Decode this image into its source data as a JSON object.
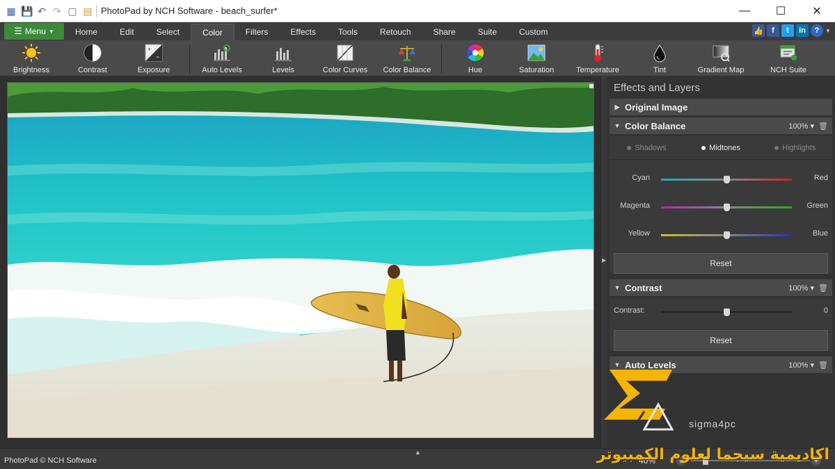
{
  "window": {
    "title": "PhotoPad by NCH Software - beach_surfer*",
    "quick_access_icons": [
      "app-icon",
      "save-icon",
      "undo-icon",
      "redo-icon",
      "new-icon",
      "paste-icon"
    ],
    "controls": {
      "minimize": "—",
      "maximize": "☐",
      "close": "✕"
    }
  },
  "tabs": {
    "menu_label": "Menu",
    "items": [
      "Home",
      "Edit",
      "Select",
      "Color",
      "Filters",
      "Effects",
      "Tools",
      "Retouch",
      "Share",
      "Suite",
      "Custom"
    ],
    "active": "Color",
    "social": [
      "like-icon",
      "facebook-icon",
      "twitter-icon",
      "linkedin-icon",
      "help-icon"
    ]
  },
  "ribbon": {
    "tools": [
      {
        "label": "Brightness",
        "icon": "sun-icon"
      },
      {
        "label": "Contrast",
        "icon": "contrast-icon"
      },
      {
        "label": "Exposure",
        "icon": "exposure-icon"
      },
      {
        "label": "Auto Levels",
        "icon": "auto-levels-icon"
      },
      {
        "label": "Levels",
        "icon": "levels-icon"
      },
      {
        "label": "Color Curves",
        "icon": "color-curves-icon"
      },
      {
        "label": "Color Balance",
        "icon": "color-balance-icon"
      },
      {
        "label": "Hue",
        "icon": "hue-wheel-icon"
      },
      {
        "label": "Saturation",
        "icon": "saturation-icon"
      },
      {
        "label": "Temperature",
        "icon": "thermometer-icon"
      },
      {
        "label": "Tint",
        "icon": "tint-drop-icon"
      },
      {
        "label": "Gradient Map",
        "icon": "gradient-map-icon"
      },
      {
        "label": "NCH Suite",
        "icon": "nch-suite-icon"
      }
    ]
  },
  "panel": {
    "title": "Effects and Layers",
    "original_image": "Original Image",
    "color_balance": {
      "title": "Color Balance",
      "opacity": "100%",
      "modes": [
        "Shadows",
        "Midtones",
        "Highlights"
      ],
      "active_mode": "Midtones",
      "sliders": [
        {
          "left": "Cyan",
          "right": "Red",
          "value": 0.5
        },
        {
          "left": "Magenta",
          "right": "Green",
          "value": 0.5
        },
        {
          "left": "Yellow",
          "right": "Blue",
          "value": 0.5
        }
      ],
      "reset": "Reset"
    },
    "contrast": {
      "title": "Contrast",
      "opacity": "100%",
      "label": "Contrast:",
      "value": "0",
      "position": 0.5,
      "reset": "Reset"
    },
    "auto_levels": {
      "title": "Auto Levels",
      "opacity": "100%"
    }
  },
  "status": {
    "text": "PhotoPad © NCH Software",
    "zoom": "40%"
  },
  "watermark": {
    "domain": "sigma4pc",
    "arabic": "اكاديمية سيجما لعلوم الكمبيوتر"
  },
  "colors": {
    "accent_green": "#3a8a3a",
    "watermark_gold": "#f4b400"
  }
}
